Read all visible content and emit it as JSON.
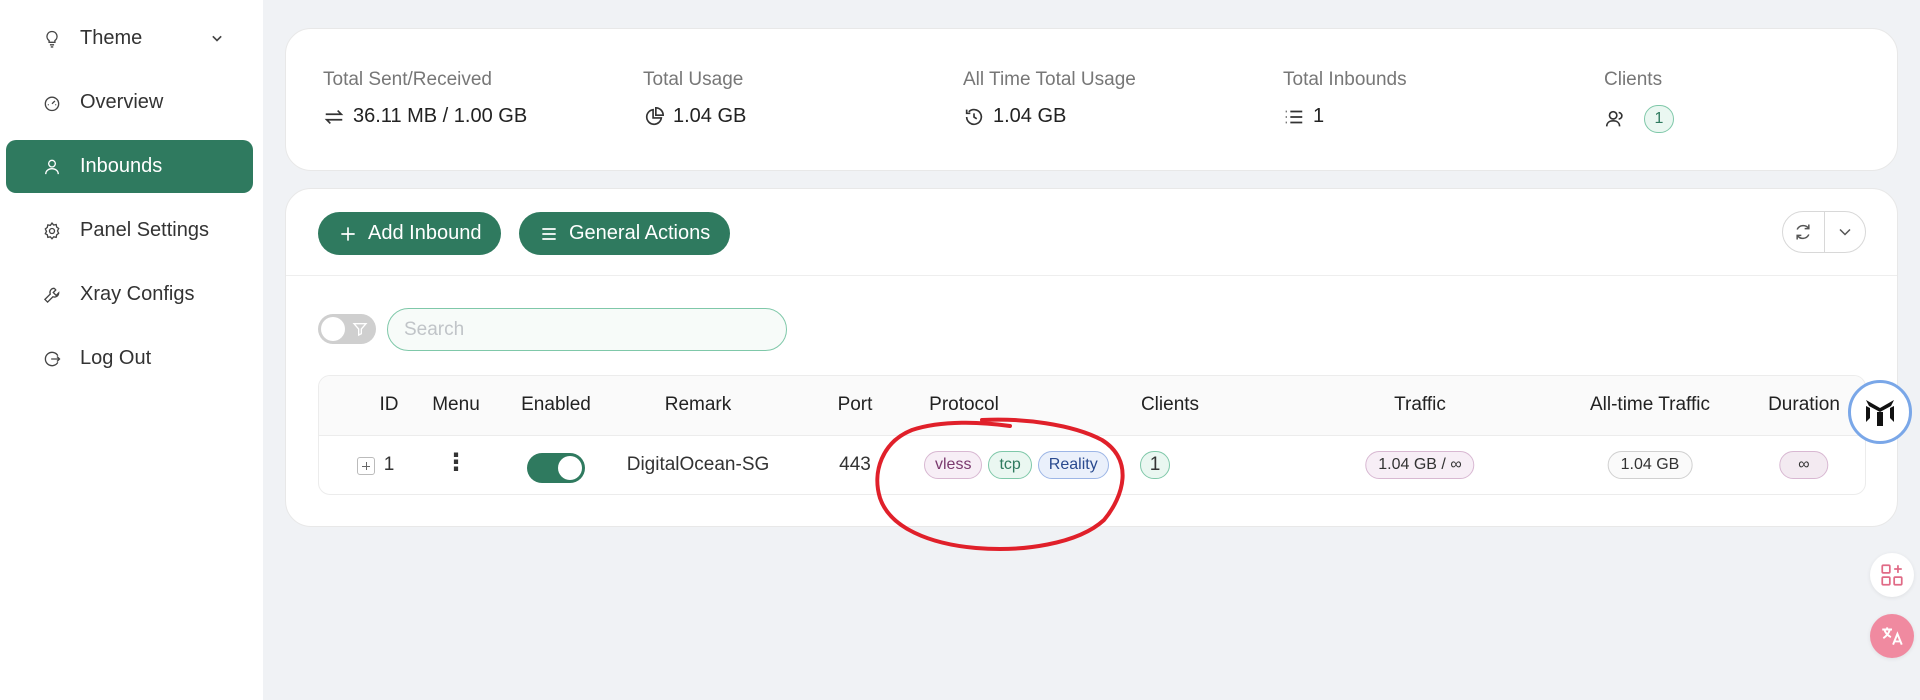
{
  "sidebar": {
    "items": [
      {
        "label": "Theme",
        "icon": "bulb-icon"
      },
      {
        "label": "Overview",
        "icon": "dashboard-icon"
      },
      {
        "label": "Inbounds",
        "icon": "user-icon",
        "active": true
      },
      {
        "label": "Panel Settings",
        "icon": "gear-icon"
      },
      {
        "label": "Xray Configs",
        "icon": "wrench-icon"
      },
      {
        "label": "Log Out",
        "icon": "logout-icon"
      }
    ]
  },
  "stats": {
    "sent_received": {
      "label": "Total Sent/Received",
      "value": "36.11 MB / 1.00 GB",
      "icon": "swap-icon"
    },
    "total_usage": {
      "label": "Total Usage",
      "value": "1.04 GB",
      "icon": "pie-chart-icon"
    },
    "all_time_usage": {
      "label": "All Time Total Usage",
      "value": "1.04 GB",
      "icon": "history-icon"
    },
    "total_inbounds": {
      "label": "Total Inbounds",
      "value": "1",
      "icon": "list-icon"
    },
    "clients": {
      "label": "Clients",
      "value": "1",
      "icon": "team-icon"
    }
  },
  "toolbar": {
    "add_inbound": "Add Inbound",
    "general_actions": "General Actions"
  },
  "search": {
    "placeholder": "Search",
    "value": ""
  },
  "table": {
    "headers": {
      "id": "ID",
      "menu": "Menu",
      "enabled": "Enabled",
      "remark": "Remark",
      "port": "Port",
      "protocol": "Protocol",
      "clients": "Clients",
      "traffic": "Traffic",
      "all_time_traffic": "All-time Traffic",
      "duration": "Duration"
    },
    "rows": [
      {
        "id": "1",
        "enabled": true,
        "remark": "DigitalOcean-SG",
        "port": "443",
        "protocol_tags": [
          "vless",
          "tcp",
          "Reality"
        ],
        "clients": "1",
        "traffic": "1.04 GB / ∞",
        "all_time_traffic": "1.04 GB",
        "duration": "∞"
      }
    ]
  },
  "colors": {
    "accent": "#2f7a5f",
    "annotation": "#e0202a"
  }
}
